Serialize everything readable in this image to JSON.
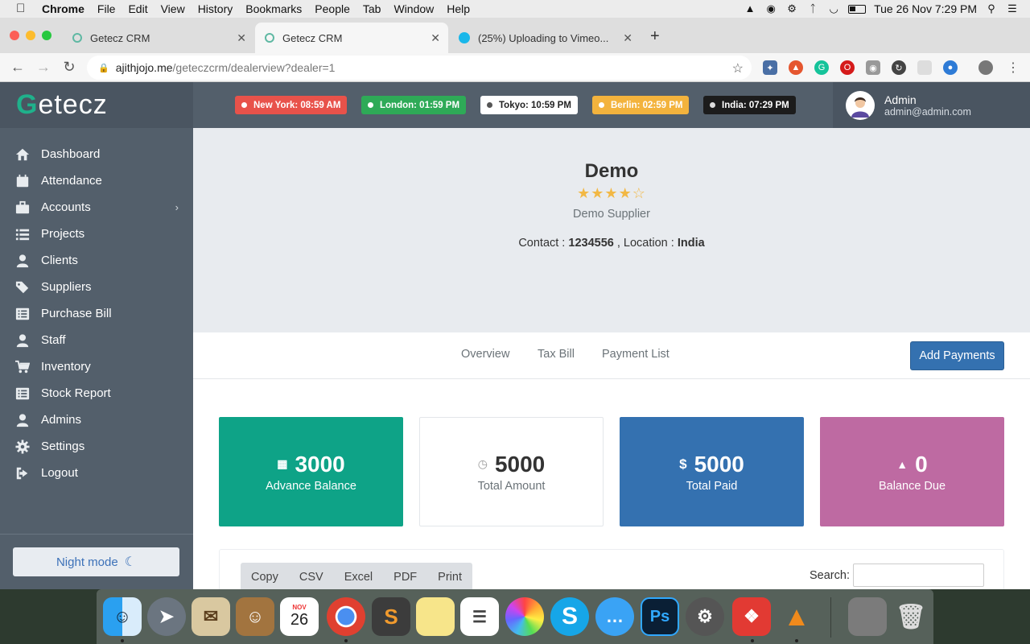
{
  "menubar": {
    "app": "Chrome",
    "items": [
      "File",
      "Edit",
      "View",
      "History",
      "Bookmarks",
      "People",
      "Tab",
      "Window",
      "Help"
    ],
    "clock": "Tue 26 Nov  7:29 PM"
  },
  "browser": {
    "tabs": [
      {
        "title": "Getecz CRM"
      },
      {
        "title": "Getecz CRM"
      },
      {
        "title": "(25%) Uploading to Vimeo..."
      }
    ],
    "url_host": "ajithjojo.me",
    "url_path": "/geteczcrm/dealerview?dealer=1"
  },
  "app": {
    "logo": "etecz",
    "logo_g": "G",
    "sidebar": [
      {
        "label": "Dashboard",
        "icon": "home-icon"
      },
      {
        "label": "Attendance",
        "icon": "calendar-icon"
      },
      {
        "label": "Accounts",
        "icon": "briefcase-icon"
      },
      {
        "label": "Projects",
        "icon": "list-icon"
      },
      {
        "label": "Clients",
        "icon": "user-icon"
      },
      {
        "label": "Suppliers",
        "icon": "tags-icon"
      },
      {
        "label": "Purchase Bill",
        "icon": "list-alt-icon"
      },
      {
        "label": "Staff",
        "icon": "user-icon"
      },
      {
        "label": "Inventory",
        "icon": "cart-icon"
      },
      {
        "label": "Stock Report",
        "icon": "list-alt-icon"
      },
      {
        "label": "Admins",
        "icon": "user-icon"
      },
      {
        "label": "Settings",
        "icon": "gear-icon"
      },
      {
        "label": "Logout",
        "icon": "sign-out-icon"
      }
    ],
    "night_mode": "Night mode",
    "clocks": [
      {
        "label": "New York: 08:59 AM",
        "color": "#e8524a"
      },
      {
        "label": "London: 01:59 PM",
        "color": "#2eaa57"
      },
      {
        "label": "Tokyo: 10:59 PM",
        "color": "#ffffff"
      },
      {
        "label": "Berlin: 02:59 PM",
        "color": "#f3b33d"
      },
      {
        "label": "India: 07:29 PM",
        "color": "#1c1c1c"
      }
    ],
    "user": {
      "name": "Admin",
      "email": "admin@admin.com"
    },
    "dealer": {
      "name": "Demo",
      "rating": 4,
      "rating_max": 5,
      "type": "Demo Supplier",
      "contact_label": "Contact : ",
      "contact": "1234556",
      "location_label": " , Location : ",
      "location": "India"
    },
    "tabs": [
      "Overview",
      "Tax Bill",
      "Payment List"
    ],
    "add_payments": "Add Payments",
    "cards": [
      {
        "value": "3000",
        "label": "Advance Balance",
        "icon": "calculator-icon",
        "color": "#0ea387"
      },
      {
        "value": "5000",
        "label": "Total Amount",
        "icon": "clock-icon",
        "color": "#ffffff"
      },
      {
        "value": "5000",
        "label": "Total Paid",
        "icon": "dollar-icon",
        "color": "#3471b0"
      },
      {
        "value": "0",
        "label": "Balance Due",
        "icon": "warning-icon",
        "color": "#be6aa2"
      }
    ],
    "table_buttons": [
      "Copy",
      "CSV",
      "Excel",
      "PDF",
      "Print"
    ],
    "search_label": "Search:"
  },
  "dock": {
    "calendar_month": "NOV",
    "calendar_day": "26"
  }
}
